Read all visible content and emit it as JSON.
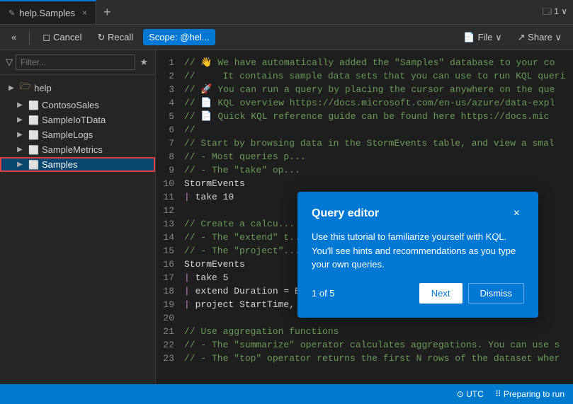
{
  "tab": {
    "label": "help.Samples",
    "icon": "✎",
    "close": "×"
  },
  "tab_add": "+",
  "tab_controls": "🗔 1 ∨",
  "toolbar": {
    "chevrons": "«",
    "cancel_label": "Cancel",
    "recall_label": "↻ Recall",
    "scope_label": "Scope: @hel...",
    "file_label": "File ∨",
    "share_label": "↗ Share ∨"
  },
  "filter": {
    "placeholder": "Filter...",
    "bookmark_icon": "★"
  },
  "tree": {
    "root": "help",
    "items": [
      {
        "label": "ContosoSales",
        "icon": "⬜",
        "indent": true,
        "expanded": false
      },
      {
        "label": "SampleIoTData",
        "icon": "⬜",
        "indent": true,
        "expanded": false
      },
      {
        "label": "SampleLogs",
        "icon": "⬜",
        "indent": true,
        "expanded": false
      },
      {
        "label": "SampleMetrics",
        "icon": "⬜",
        "indent": true,
        "expanded": false
      },
      {
        "label": "Samples",
        "icon": "⬜",
        "indent": true,
        "expanded": false,
        "selected": true
      }
    ]
  },
  "code": {
    "lines": [
      {
        "num": 1,
        "content": "comment",
        "text": "// 👋 We have automatically added the \"Samples\" database to your co"
      },
      {
        "num": 2,
        "content": "comment",
        "text": "//     It contains sample data sets that you can use to run KQL queri"
      },
      {
        "num": 3,
        "content": "comment",
        "text": "// 🚀 You can run a query by placing the cursor anywhere on the que"
      },
      {
        "num": 4,
        "content": "comment",
        "text": "// 📄 KQL overview https://docs.microsoft.com/en-us/azure/data-expl"
      },
      {
        "num": 5,
        "content": "comment",
        "text": "// 📄 Quick KQL reference guide can be found here https://docs.mic"
      },
      {
        "num": 6,
        "content": "comment",
        "text": "//"
      },
      {
        "num": 7,
        "content": "comment",
        "text": "// Start by browsing data in the StormEvents table, and view a smal"
      },
      {
        "num": 8,
        "content": "comment",
        "text": "// - Most queries p..."
      },
      {
        "num": 9,
        "content": "comment",
        "text": "// - The \"take\" op..."
      },
      {
        "num": 10,
        "content": "normal",
        "text": "StormEvents"
      },
      {
        "num": 11,
        "content": "pipe",
        "text": "| take 10"
      },
      {
        "num": 12,
        "content": "empty",
        "text": ""
      },
      {
        "num": 13,
        "content": "comment",
        "text": "// Create a calcu..."
      },
      {
        "num": 14,
        "content": "comment",
        "text": "// - The \"extend\" t..."
      },
      {
        "num": 15,
        "content": "comment",
        "text": "// - The \"project\"..."
      },
      {
        "num": 16,
        "content": "normal",
        "text": "StormEvents"
      },
      {
        "num": 17,
        "content": "pipe",
        "text": "| take 5"
      },
      {
        "num": 18,
        "content": "pipe",
        "text": "| extend Duration = EndTime - StartTime"
      },
      {
        "num": 19,
        "content": "pipe",
        "text": "| project StartTime, EndTime, Duration, EventType, State;"
      },
      {
        "num": 20,
        "content": "empty",
        "text": ""
      },
      {
        "num": 21,
        "content": "comment",
        "text": "// Use aggregation functions"
      },
      {
        "num": 22,
        "content": "comment",
        "text": "// - The \"summarize\" operator calculates aggregations. You can use s"
      },
      {
        "num": 23,
        "content": "comment",
        "text": "// - The \"top\" operator returns the first N rows of the dataset wher"
      }
    ]
  },
  "popup": {
    "title": "Query editor",
    "body": "Use this tutorial to familiarize yourself with KQL. You'll see hints and recommendations as you type your own queries.",
    "counter": "1 of 5",
    "next_label": "Next",
    "dismiss_label": "Dismiss",
    "close_icon": "×"
  },
  "status": {
    "utc_label": "⊙ UTC",
    "spinner_label": "⠿ Preparing to run"
  }
}
